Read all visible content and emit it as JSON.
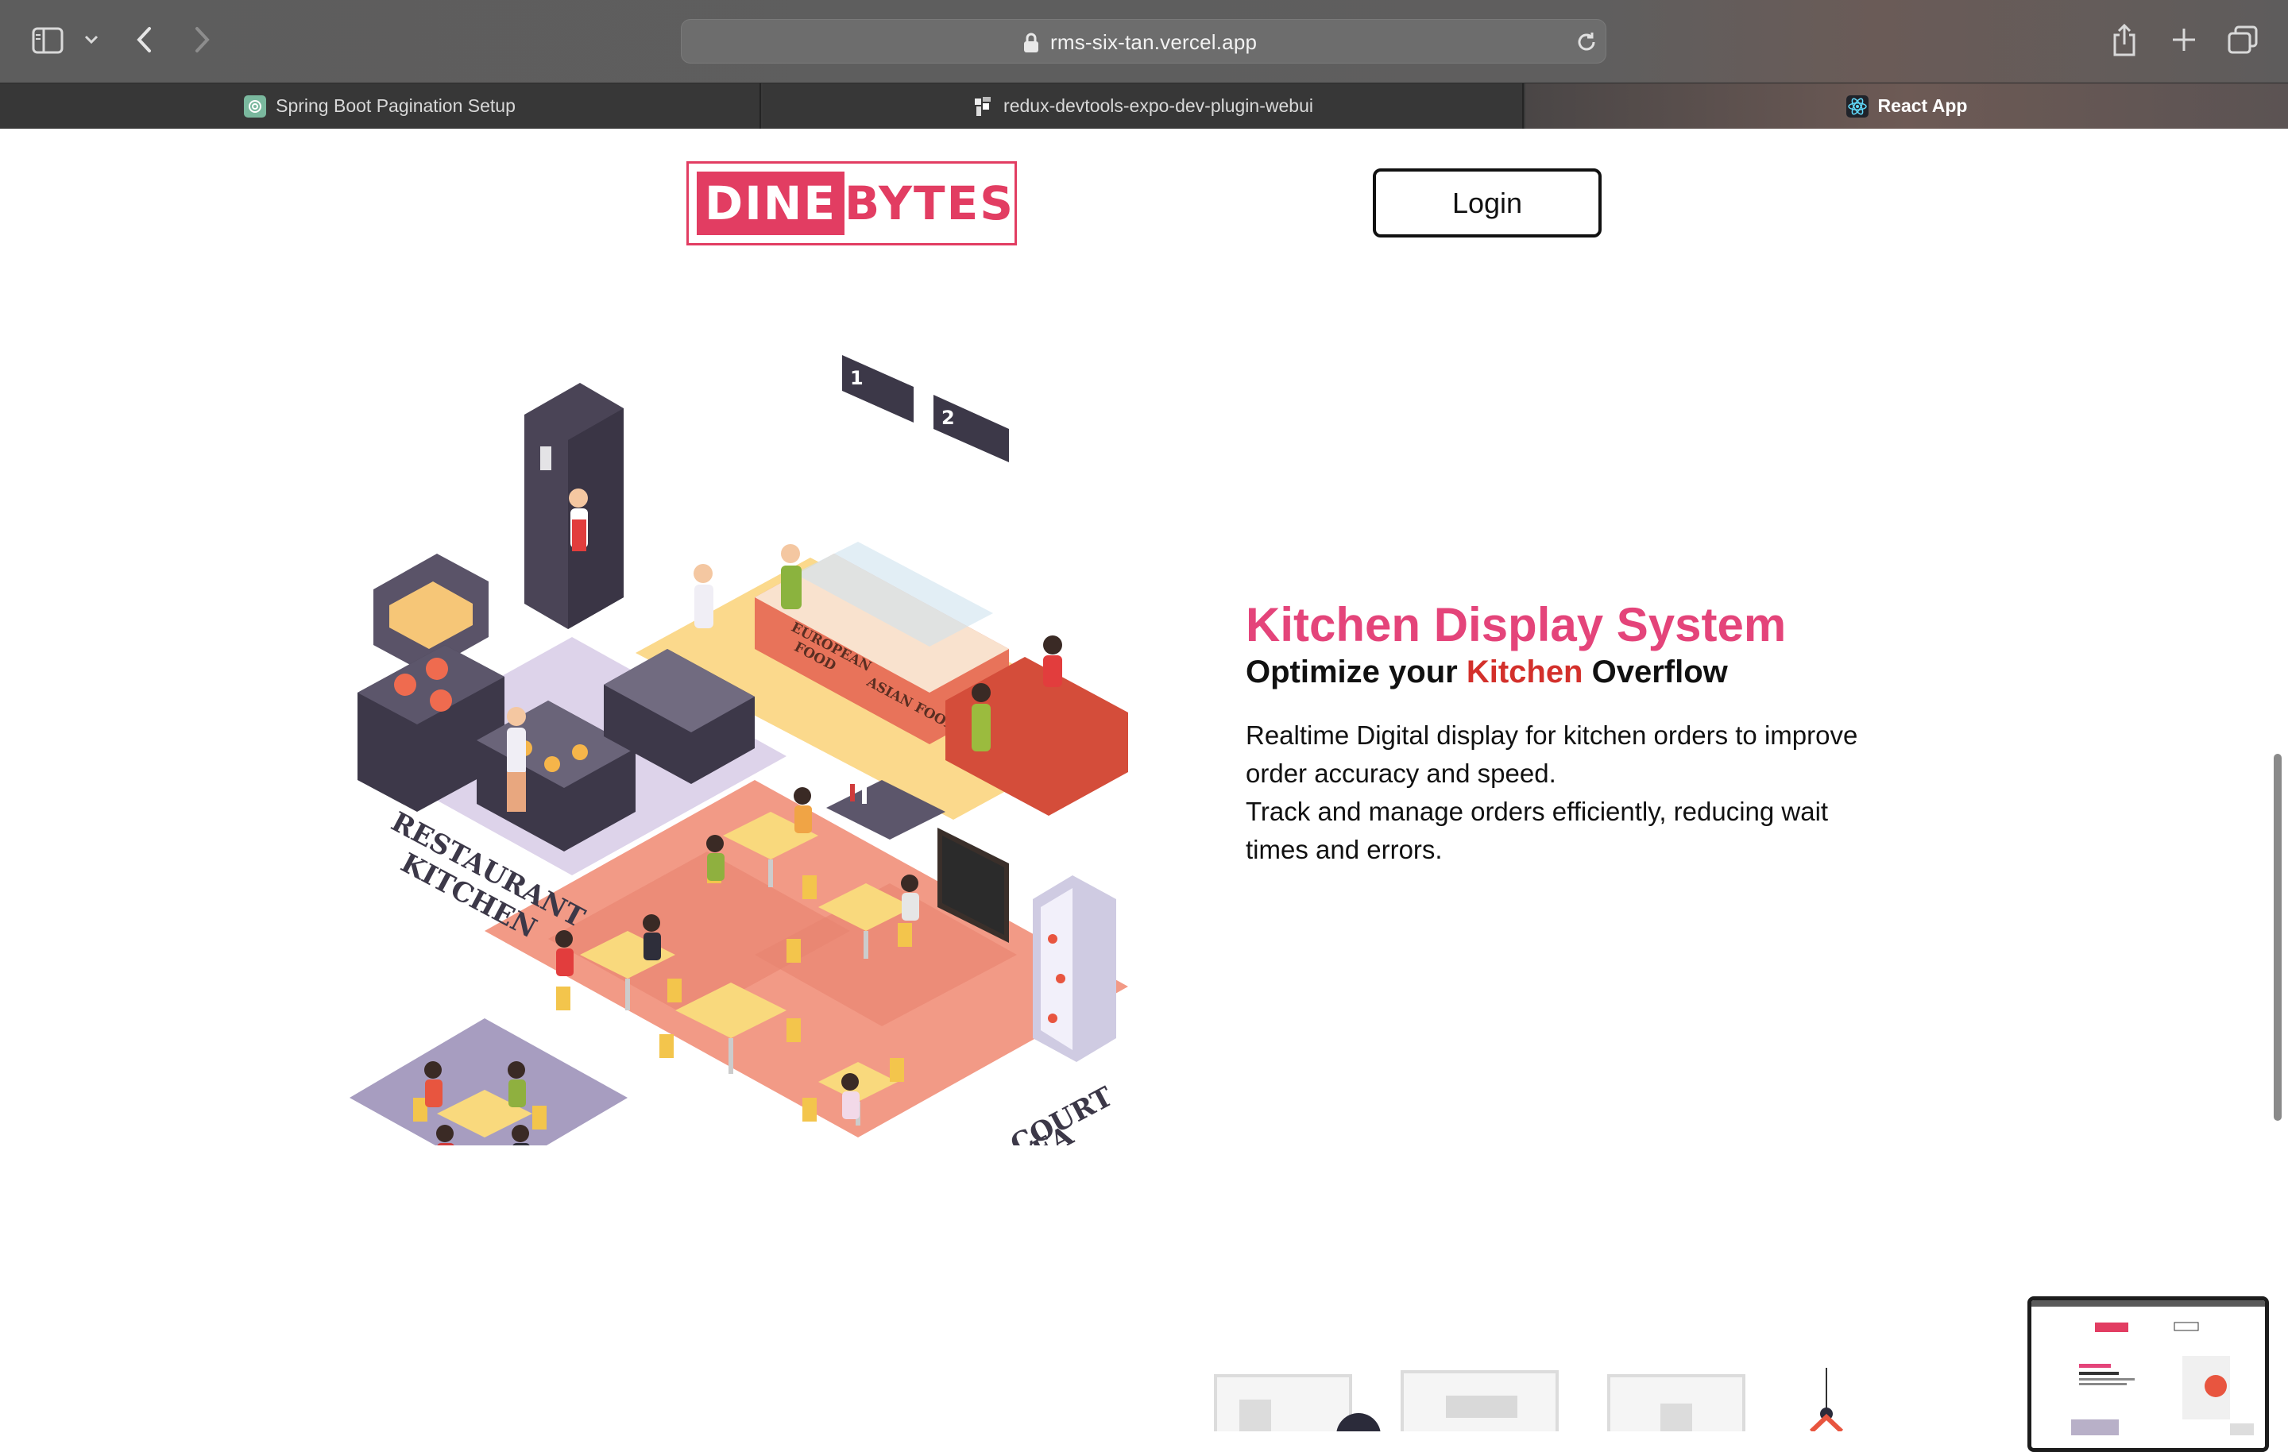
{
  "browser": {
    "url": "rms-six-tan.vercel.app",
    "tabs": [
      {
        "label": "Spring Boot Pagination Setup",
        "favicon": "chatgpt-icon",
        "active": false
      },
      {
        "label": "redux-devtools-expo-dev-plugin-webui",
        "favicon": "github-icon",
        "active": false
      },
      {
        "label": "React App",
        "favicon": "react-icon",
        "active": true
      }
    ],
    "toolbar_icons": [
      "sidebar-icon",
      "chevron-down-icon",
      "back-icon",
      "forward-icon",
      "share-icon",
      "new-tab-icon",
      "tab-overview-icon"
    ]
  },
  "header": {
    "logo_left": "DINE",
    "logo_right": "BYTES",
    "login_label": "Login"
  },
  "hero": {
    "title": "Kitchen Display System",
    "subtitle_prefix": "Optimize your ",
    "subtitle_accent": "Kitchen",
    "subtitle_suffix": " Overflow",
    "desc_line1": "Realtime Digital display for kitchen orders to improve order accuracy and speed.",
    "desc_line2": "Track and manage orders efficiently, reducing wait times and errors."
  },
  "illustration": {
    "label_kitchen_1": "RESTAURANT",
    "label_kitchen_2": "KITCHEN",
    "label_food_court_1": "FOOD COURT",
    "label_food_court_2": "AREA",
    "label_european_1": "EUROPEAN",
    "label_european_2": "FOOD",
    "label_asian": "ASIAN FOOD",
    "sign_1": "1",
    "sign_2": "2"
  },
  "colors": {
    "brand": "#e23d62",
    "title": "#e4447a",
    "accent": "#d3302b"
  }
}
